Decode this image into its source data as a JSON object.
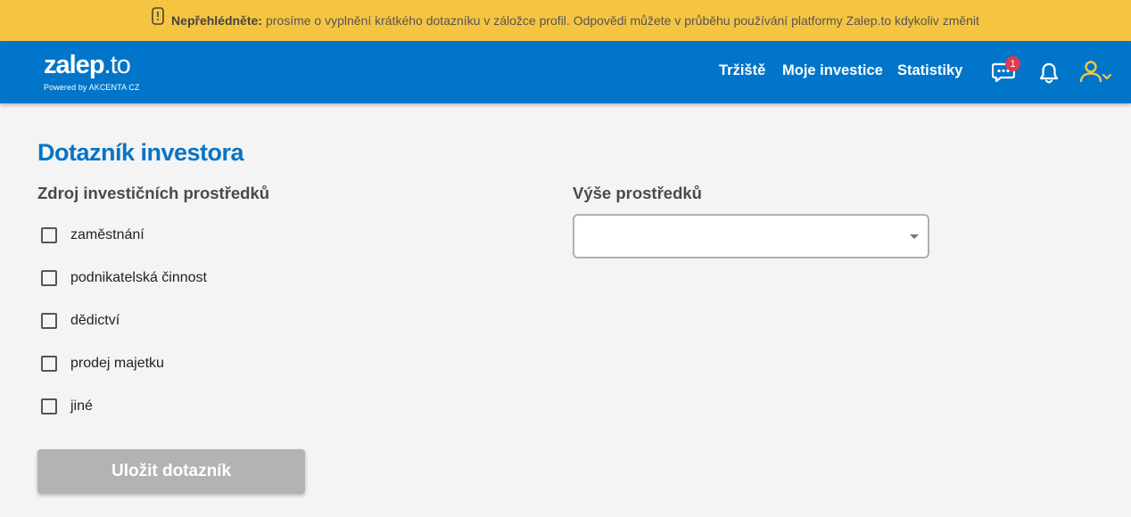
{
  "notice": {
    "bold": "Nepřehlédněte:",
    "text": "prosíme o vyplnění krátkého dotazníku v záložce profil. Odpovědi můžete v průběhu používání platformy Zalep.to kdykoliv změnit"
  },
  "brand": {
    "name_main": "zalep",
    "name_suffix": ".to",
    "powered": "Powered by AKCENTA CZ"
  },
  "nav": {
    "items": [
      "Tržiště",
      "Moje investice",
      "Statistiky"
    ],
    "messages_badge": "1",
    "icons": [
      "chat-icon",
      "bell-icon",
      "user-icon",
      "chevron-down-icon"
    ]
  },
  "page": {
    "title": "Dotazník investora"
  },
  "form": {
    "source_title": "Zdroj investičních prostředků",
    "source_options": [
      "zaměstnání",
      "podnikatelská činnost",
      "dědictví",
      "prodej majetku",
      "jiné"
    ],
    "amount_title": "Výše prostředků",
    "amount_value": "",
    "save_label": "Uložit dotazník"
  },
  "colors": {
    "notice_bg": "#f5c542",
    "navbar_bg": "#0075c9",
    "title": "#0a73c4",
    "button_disabled": "#b3b3b3",
    "badge": "#e03a4e",
    "user_icon": "#f5c542"
  }
}
